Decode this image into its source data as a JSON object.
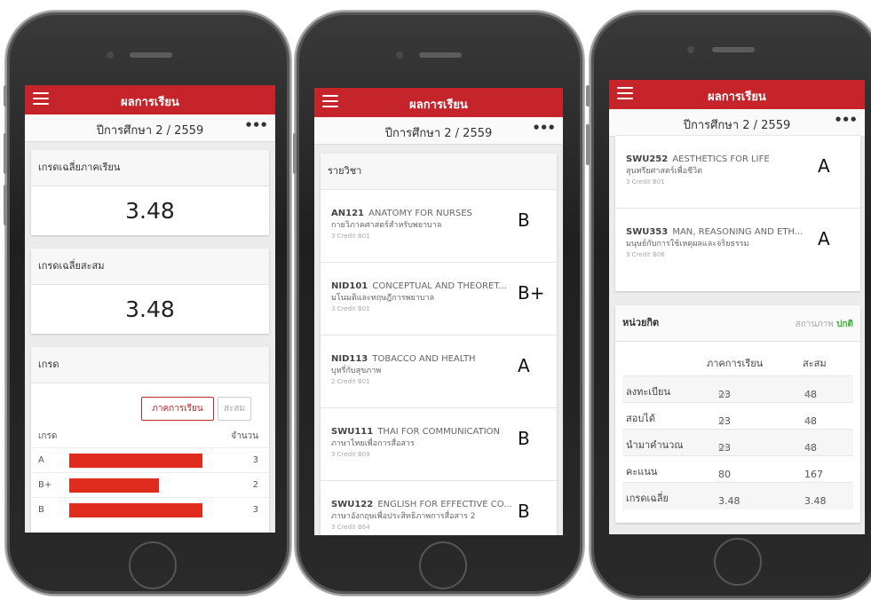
{
  "app": {
    "title": "ผลการเรียน",
    "year_label": "ปีการศึกษา 2 / 2559",
    "more": "•••"
  },
  "screen1": {
    "sem_gpa_label": "เกรดเฉลี่ยภาคเรียน",
    "sem_gpa_value": "3.48",
    "cum_gpa_label": "เกรดเฉลี่ยสะสม",
    "cum_gpa_value": "3.48",
    "grade_section_label": "เกรด",
    "btn_semester": "ภาคการเรียน",
    "btn_cumulative": "สะสม",
    "col_grade": "เกรด",
    "col_count": "จำนวน",
    "distribution": [
      {
        "grade": "A",
        "count": "3",
        "fraction": 1.0
      },
      {
        "grade": "B+",
        "count": "2",
        "fraction": 0.67
      },
      {
        "grade": "B",
        "count": "3",
        "fraction": 1.0
      }
    ],
    "bar_color": "#e02b1f"
  },
  "screen2": {
    "courses_label": "รายวิชา",
    "courses": [
      {
        "code": "AN121",
        "name_en": "ANATOMY FOR NURSES",
        "name_th": "กายวิภาคศาสตร์สำหรับพยาบาล",
        "credit": "3 Credit B01",
        "grade": "B"
      },
      {
        "code": "NID101",
        "name_en": "CONCEPTUAL AND THEORET...",
        "name_th": "มโนมติและทฤษฎีการพยาบาล",
        "credit": "3 Credit B01",
        "grade": "B+"
      },
      {
        "code": "NID113",
        "name_en": "TOBACCO AND HEALTH",
        "name_th": "บุหรี่กับสุขภาพ",
        "credit": "2 Credit B01",
        "grade": "A"
      },
      {
        "code": "SWU111",
        "name_en": "THAI FOR COMMUNICATION",
        "name_th": "ภาษาไทยเพื่อการสื่อสาร",
        "credit": "3 Credit B09",
        "grade": "B"
      },
      {
        "code": "SWU122",
        "name_en": "ENGLISH FOR EFFECTIVE CO...",
        "name_th": "ภาษาอังกฤษเพื่อประสิทธิภาพการสื่อสาร 2",
        "credit": "3 Credit B64",
        "grade": "B"
      }
    ]
  },
  "screen3": {
    "courses": [
      {
        "code": "SWU252",
        "name_en": "AESTHETICS FOR LIFE",
        "name_th": "สุนทรียศาสตร์เพื่อชีวิต",
        "credit": "3 Credit B01",
        "grade": "A"
      },
      {
        "code": "SWU353",
        "name_en": "MAN, REASONING AND ETH...",
        "name_th": "มนุษย์กับการใช้เหตุผลและจริยธรรม",
        "credit": "3 Credit B06",
        "grade": "A"
      }
    ],
    "credits_label": "หน่วยกิต",
    "status_label": "สถานภาพ",
    "status_value": "ปกติ",
    "status_color": "#3cb034",
    "col_semester": "ภาคการเรียน",
    "col_cumulative": "สะสม",
    "rows": [
      {
        "label": "ลงทะเบียน",
        "sem": "23",
        "sem_unit": "นก.",
        "cum": "48",
        "cum_unit": "นก."
      },
      {
        "label": "สอบได้",
        "sem": "23",
        "sem_unit": "นก.",
        "cum": "48",
        "cum_unit": "นก."
      },
      {
        "label": "นำมาคำนวณ",
        "sem": "23",
        "sem_unit": "นก.",
        "cum": "48",
        "cum_unit": "นก."
      },
      {
        "label": "คะแนน",
        "sem": "80",
        "sem_unit": "",
        "cum": "167",
        "cum_unit": ""
      },
      {
        "label": "เกรดเฉลี่ย",
        "sem": "3.48",
        "sem_unit": "",
        "cum": "3.48",
        "cum_unit": ""
      }
    ]
  }
}
